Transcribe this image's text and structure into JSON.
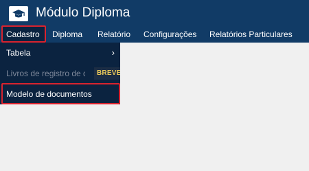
{
  "header": {
    "logo_icon": "graduation-cap-icon",
    "title": "Módulo Diploma",
    "background": "#113b66"
  },
  "nav": {
    "items": [
      {
        "label": "Cadastro",
        "active": true
      },
      {
        "label": "Diploma"
      },
      {
        "label": "Relatório"
      },
      {
        "label": "Configurações"
      },
      {
        "label": "Relatórios Particulares"
      }
    ]
  },
  "dropdown": {
    "items": [
      {
        "label": "Tabela",
        "submenu_icon": "chevron-right-icon",
        "chevron": "›"
      },
      {
        "label": "Livros de registro de diplomas",
        "disabled": true,
        "badge": "BREVE"
      },
      {
        "label": "Modelo de documentos",
        "highlighted": true
      }
    ],
    "background": "#0b2340"
  },
  "highlight_color": "#d9232e"
}
